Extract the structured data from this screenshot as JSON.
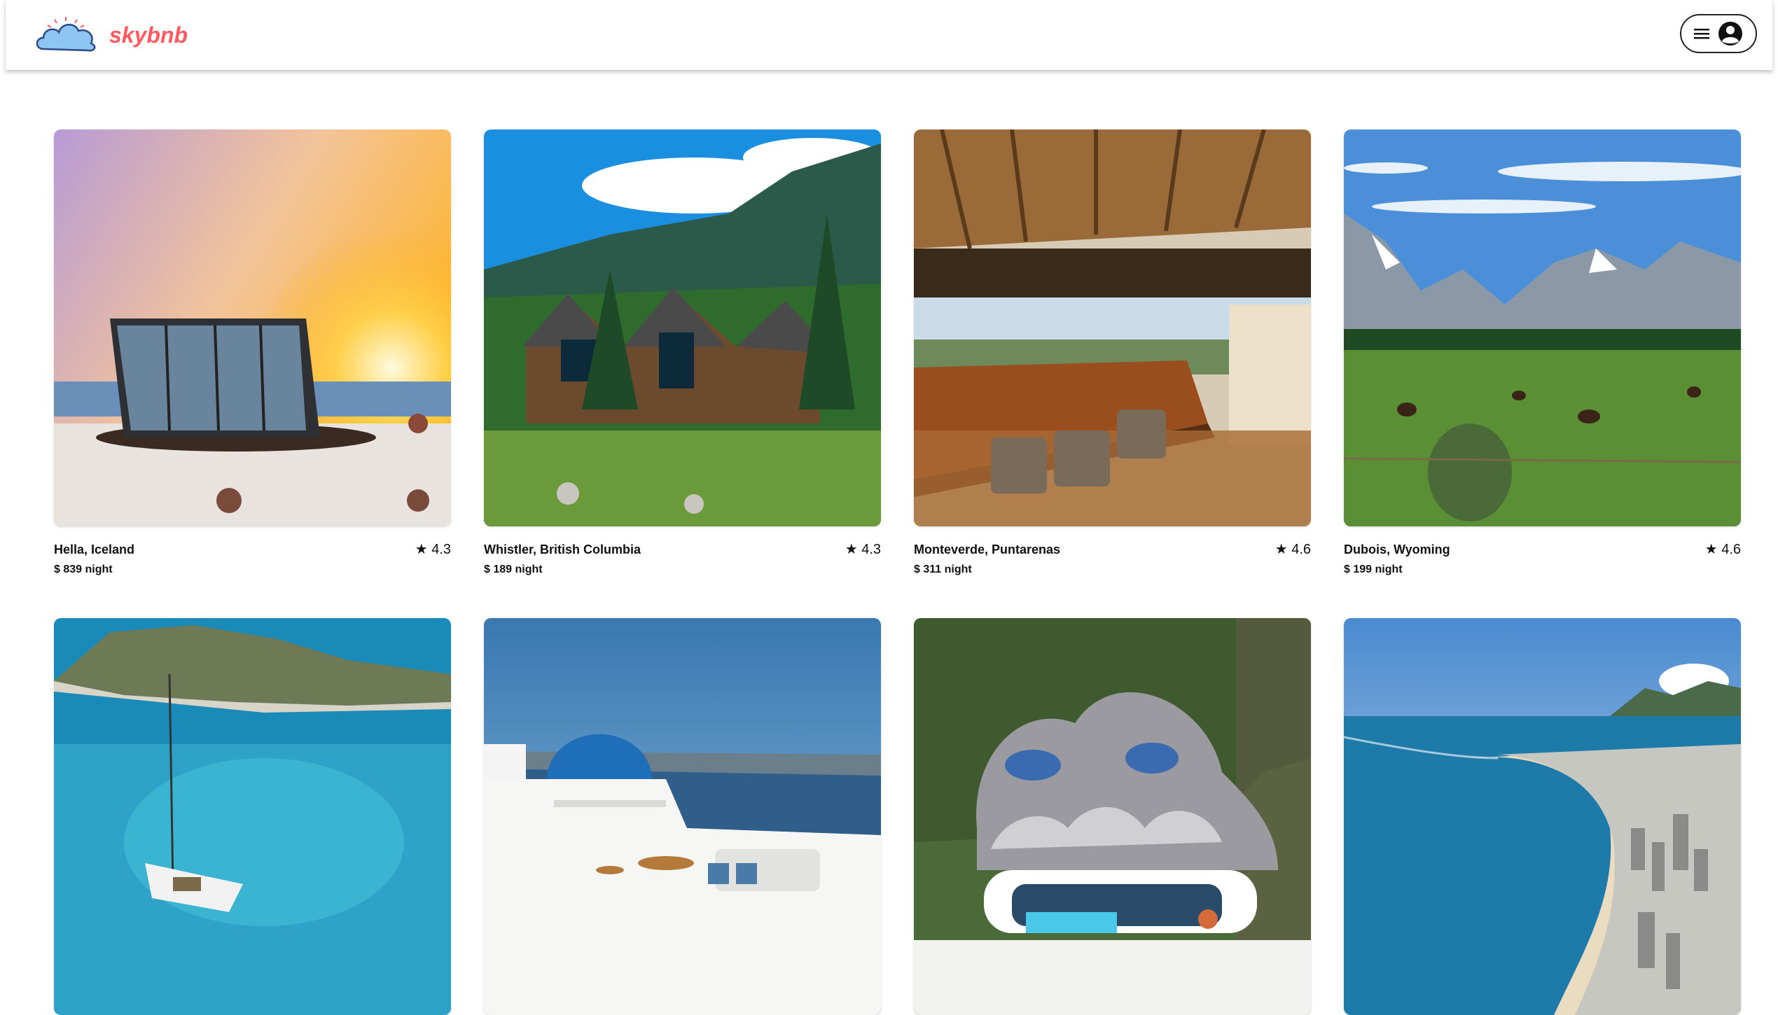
{
  "app": {
    "brand": "skybnb",
    "brand_color": "#ff5a5f"
  },
  "header": {
    "menu_icon": "hamburger-icon",
    "avatar_icon": "user-circle-icon"
  },
  "listings": [
    {
      "location": "Hella, Iceland",
      "rating": "★ 4.3",
      "price": "$ 839 night",
      "image": "glass-cabin-sunset"
    },
    {
      "location": "Whistler, British Columbia",
      "rating": "★ 4.3",
      "price": "$ 189 night",
      "image": "mountain-chalet"
    },
    {
      "location": "Monteverde, Puntarenas",
      "rating": "★ 4.6",
      "price": "$ 311 night",
      "image": "treehouse-kitchen"
    },
    {
      "location": "Dubois, Wyoming",
      "rating": "★ 4.6",
      "price": "$ 199 night",
      "image": "mountain-meadow-bison"
    },
    {
      "location": "",
      "rating": "",
      "price": "",
      "image": "island-sailboat"
    },
    {
      "location": "",
      "rating": "",
      "price": "",
      "image": "santorini-dome"
    },
    {
      "location": "",
      "rating": "",
      "price": "",
      "image": "organic-modern-villa"
    },
    {
      "location": "",
      "rating": "",
      "price": "",
      "image": "coastal-city-beach"
    }
  ]
}
